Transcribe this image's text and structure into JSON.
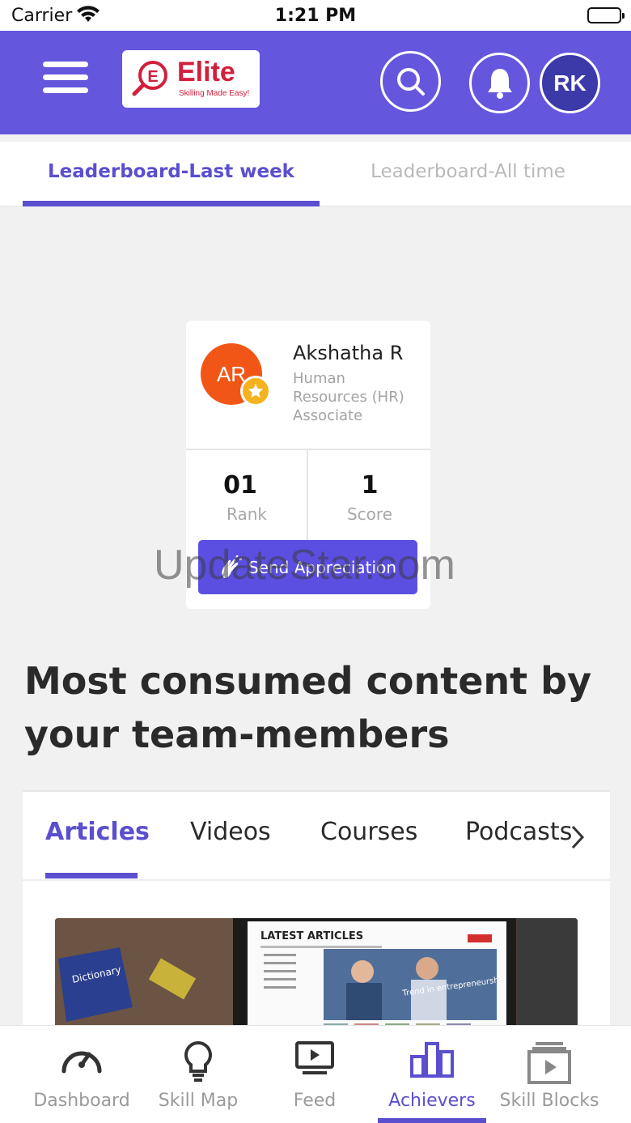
{
  "status_bar": {
    "carrier": "Carrier",
    "time": "1:21 PM"
  },
  "header": {
    "logo_text": "Elite",
    "logo_tagline": "Skilling Made Easy!",
    "avatar_initials": "RK",
    "color": "#6556de"
  },
  "leaderboard_tabs": [
    {
      "label": "Leaderboard-Last week",
      "active": true
    },
    {
      "label": "Leaderboard-All time",
      "active": false
    }
  ],
  "leader": {
    "initials": "AR",
    "name": "Akshatha R",
    "role": "Human Resources (HR) Associate",
    "rank_value": "01",
    "rank_label": "Rank",
    "score_value": "1",
    "score_label": "Score",
    "appreciation_button": "Send Appreciation"
  },
  "watermark": "UpdateStar.com",
  "section_title": "Most consumed content by your team-members",
  "content_tabs": [
    {
      "label": "Articles",
      "active": true
    },
    {
      "label": "Videos",
      "active": false
    },
    {
      "label": "Courses",
      "active": false
    },
    {
      "label": "Podcasts",
      "active": false
    }
  ],
  "thumbnail": {
    "heading": "LATEST ARTICLES",
    "caption": "Trend in entrepreneurship"
  },
  "bottom_nav": [
    {
      "label": "Dashboard",
      "icon": "speedometer-icon",
      "active": false
    },
    {
      "label": "Skill Map",
      "icon": "lightbulb-icon",
      "active": false
    },
    {
      "label": "Feed",
      "icon": "play-screen-icon",
      "active": false
    },
    {
      "label": "Achievers",
      "icon": "bar-chart-icon",
      "active": true
    },
    {
      "label": "Skill Blocks",
      "icon": "stacked-play-icon",
      "active": false
    }
  ],
  "accent_color": "#5a4fcf"
}
